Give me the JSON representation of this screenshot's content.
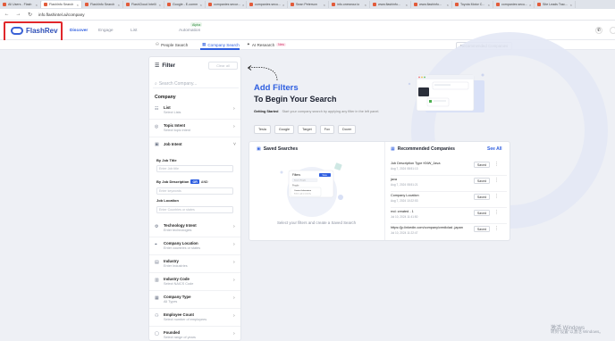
{
  "browser": {
    "tabs": [
      {
        "label": "All Users - Flash"
      },
      {
        "label": "FlashInfo Search",
        "active": true
      },
      {
        "label": "FlashInfo Search"
      },
      {
        "label": "FlashCloud Intelli"
      },
      {
        "label": "Google - E-comm"
      },
      {
        "label": "companies secur..."
      },
      {
        "label": "companies secu..."
      },
      {
        "label": "Sean Peterson"
      },
      {
        "label": "info.onesecur.io"
      },
      {
        "label": "www.flashinfo..."
      },
      {
        "label": "www.flashinfo..."
      },
      {
        "label": "Toyota Motor C..."
      },
      {
        "label": "companies secu..."
      },
      {
        "label": "Site Leads Trac..."
      }
    ],
    "url": "info.flashintel.ai/company"
  },
  "header": {
    "logo_text": "FlashRev",
    "nav": [
      {
        "label": "Discover",
        "active": true
      },
      {
        "label": "Engage"
      },
      {
        "label": "List"
      },
      {
        "label": "Automation"
      }
    ],
    "alpha_badge": "Alpha"
  },
  "subtabs": {
    "people": "People Search",
    "company": "Company Search",
    "ai": "AI Research",
    "new_badge": "New",
    "recommended_button": "Recommended Companies"
  },
  "filters": {
    "title": "Filter",
    "clear_all": "Clear all",
    "search_placeholder": "Search Company...",
    "section_company": "Company",
    "list": {
      "label": "List",
      "sub": "Select Lists"
    },
    "topic": {
      "label": "Topic Intent",
      "sub": "Select topic intent"
    },
    "job": {
      "label": "Job Intent",
      "sub": ""
    },
    "by_job_title": "By Job Title",
    "job_title_placeholder": "Enter Job title",
    "by_job_desc": "By Job Description",
    "or": "OR",
    "and": "AND",
    "keywords_placeholder": "Enter keywords",
    "job_location": "Job Location",
    "job_location_placeholder": "Enter Countries or states",
    "items": [
      {
        "label": "Technology Intent",
        "sub": "Enter technologies"
      },
      {
        "label": "Company Location",
        "sub": "Enter countries or states"
      },
      {
        "label": "Industry",
        "sub": "Enter Industries"
      },
      {
        "label": "Industry Code",
        "sub": "Select NAICS Code"
      },
      {
        "label": "Company Type",
        "sub": "All Types"
      },
      {
        "label": "Employee Count",
        "sub": "Select number of employees"
      },
      {
        "label": "Founded",
        "sub": "Select range of years"
      }
    ]
  },
  "main": {
    "title": "Add Filters",
    "subtitle": "To Begin Your Search",
    "getting_started": "Getting Started",
    "getting_started_text": "Start your company search by applying any filter in the left panel.",
    "chips": [
      "Tesla",
      "Google",
      "Target",
      "Fox",
      "Dover"
    ]
  },
  "saved": {
    "title": "Saved Searches",
    "empty_text": "Select your filters and create a Saved Search",
    "illus_filters": "Filters",
    "illus_save": "Save",
    "illus_search": "Search People",
    "illus_people": "People",
    "illus_line1": "Contact Information",
    "illus_line2": "Select a job or seniority"
  },
  "recommended": {
    "title": "Recommended Companies",
    "see_all": "See All",
    "saved_label": "Saved",
    "rows": [
      {
        "name": "Job Description Type KNW_Java",
        "date": "Aug 7, 2024 08:51:13"
      },
      {
        "name": "java",
        "date": "Aug 7, 2024 08:51:21"
      },
      {
        "name": "Company Location",
        "date": "Aug 7, 2024 10:22:53"
      },
      {
        "name": "rnd: created - 1",
        "date": "Jul 10, 2024 11:41:50"
      },
      {
        "name": "https://jp.linkedin.com/company/crediclad -japan",
        "date": "Jul 10, 2024 11:22:47"
      }
    ]
  },
  "watermark": {
    "line1": "激活 Windows",
    "line2": "转到\"设置\"以激活 Windows。"
  },
  "colors": {
    "accent": "#2e5ee0",
    "highlight_box": "#e0262a",
    "background": "#eef0f5"
  }
}
